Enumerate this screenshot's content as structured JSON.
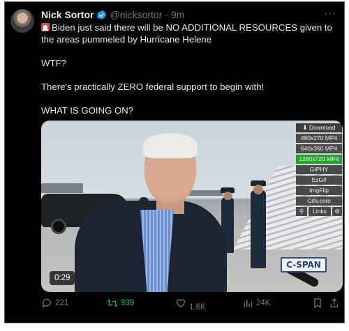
{
  "tweet": {
    "name": "Nick Sortor",
    "handle": "@nicksortor",
    "separator": "·",
    "time": "9m",
    "more": "···",
    "lines": [
      "Biden just said there will be NO ADDITIONAL RESOURCES given to the areas pummeled by Hurricane Helene",
      "WTF?",
      "There's practically ZERO federal support to begin with!",
      "WHAT IS GOING ON?"
    ]
  },
  "video": {
    "duration": "0:29",
    "watermark": "C-SPAN",
    "download_panel": {
      "header": "Download",
      "options": [
        "480x270 MP4",
        "640x360 MP4",
        "1280x720 MP4",
        "GIPHY",
        "EzGif",
        "ImgFlip",
        "Gifs.com"
      ],
      "highlighted": "1280x720 MP4",
      "links": "Links"
    }
  },
  "actions": {
    "replies": "221",
    "reposts": "939",
    "likes": "1.6K",
    "views": "24K"
  },
  "colors": {
    "repost_green": "#00ba7c",
    "verified_blue": "#1d9bf0",
    "muted_gray": "#71767b",
    "highlight_green": "#23a42a"
  }
}
